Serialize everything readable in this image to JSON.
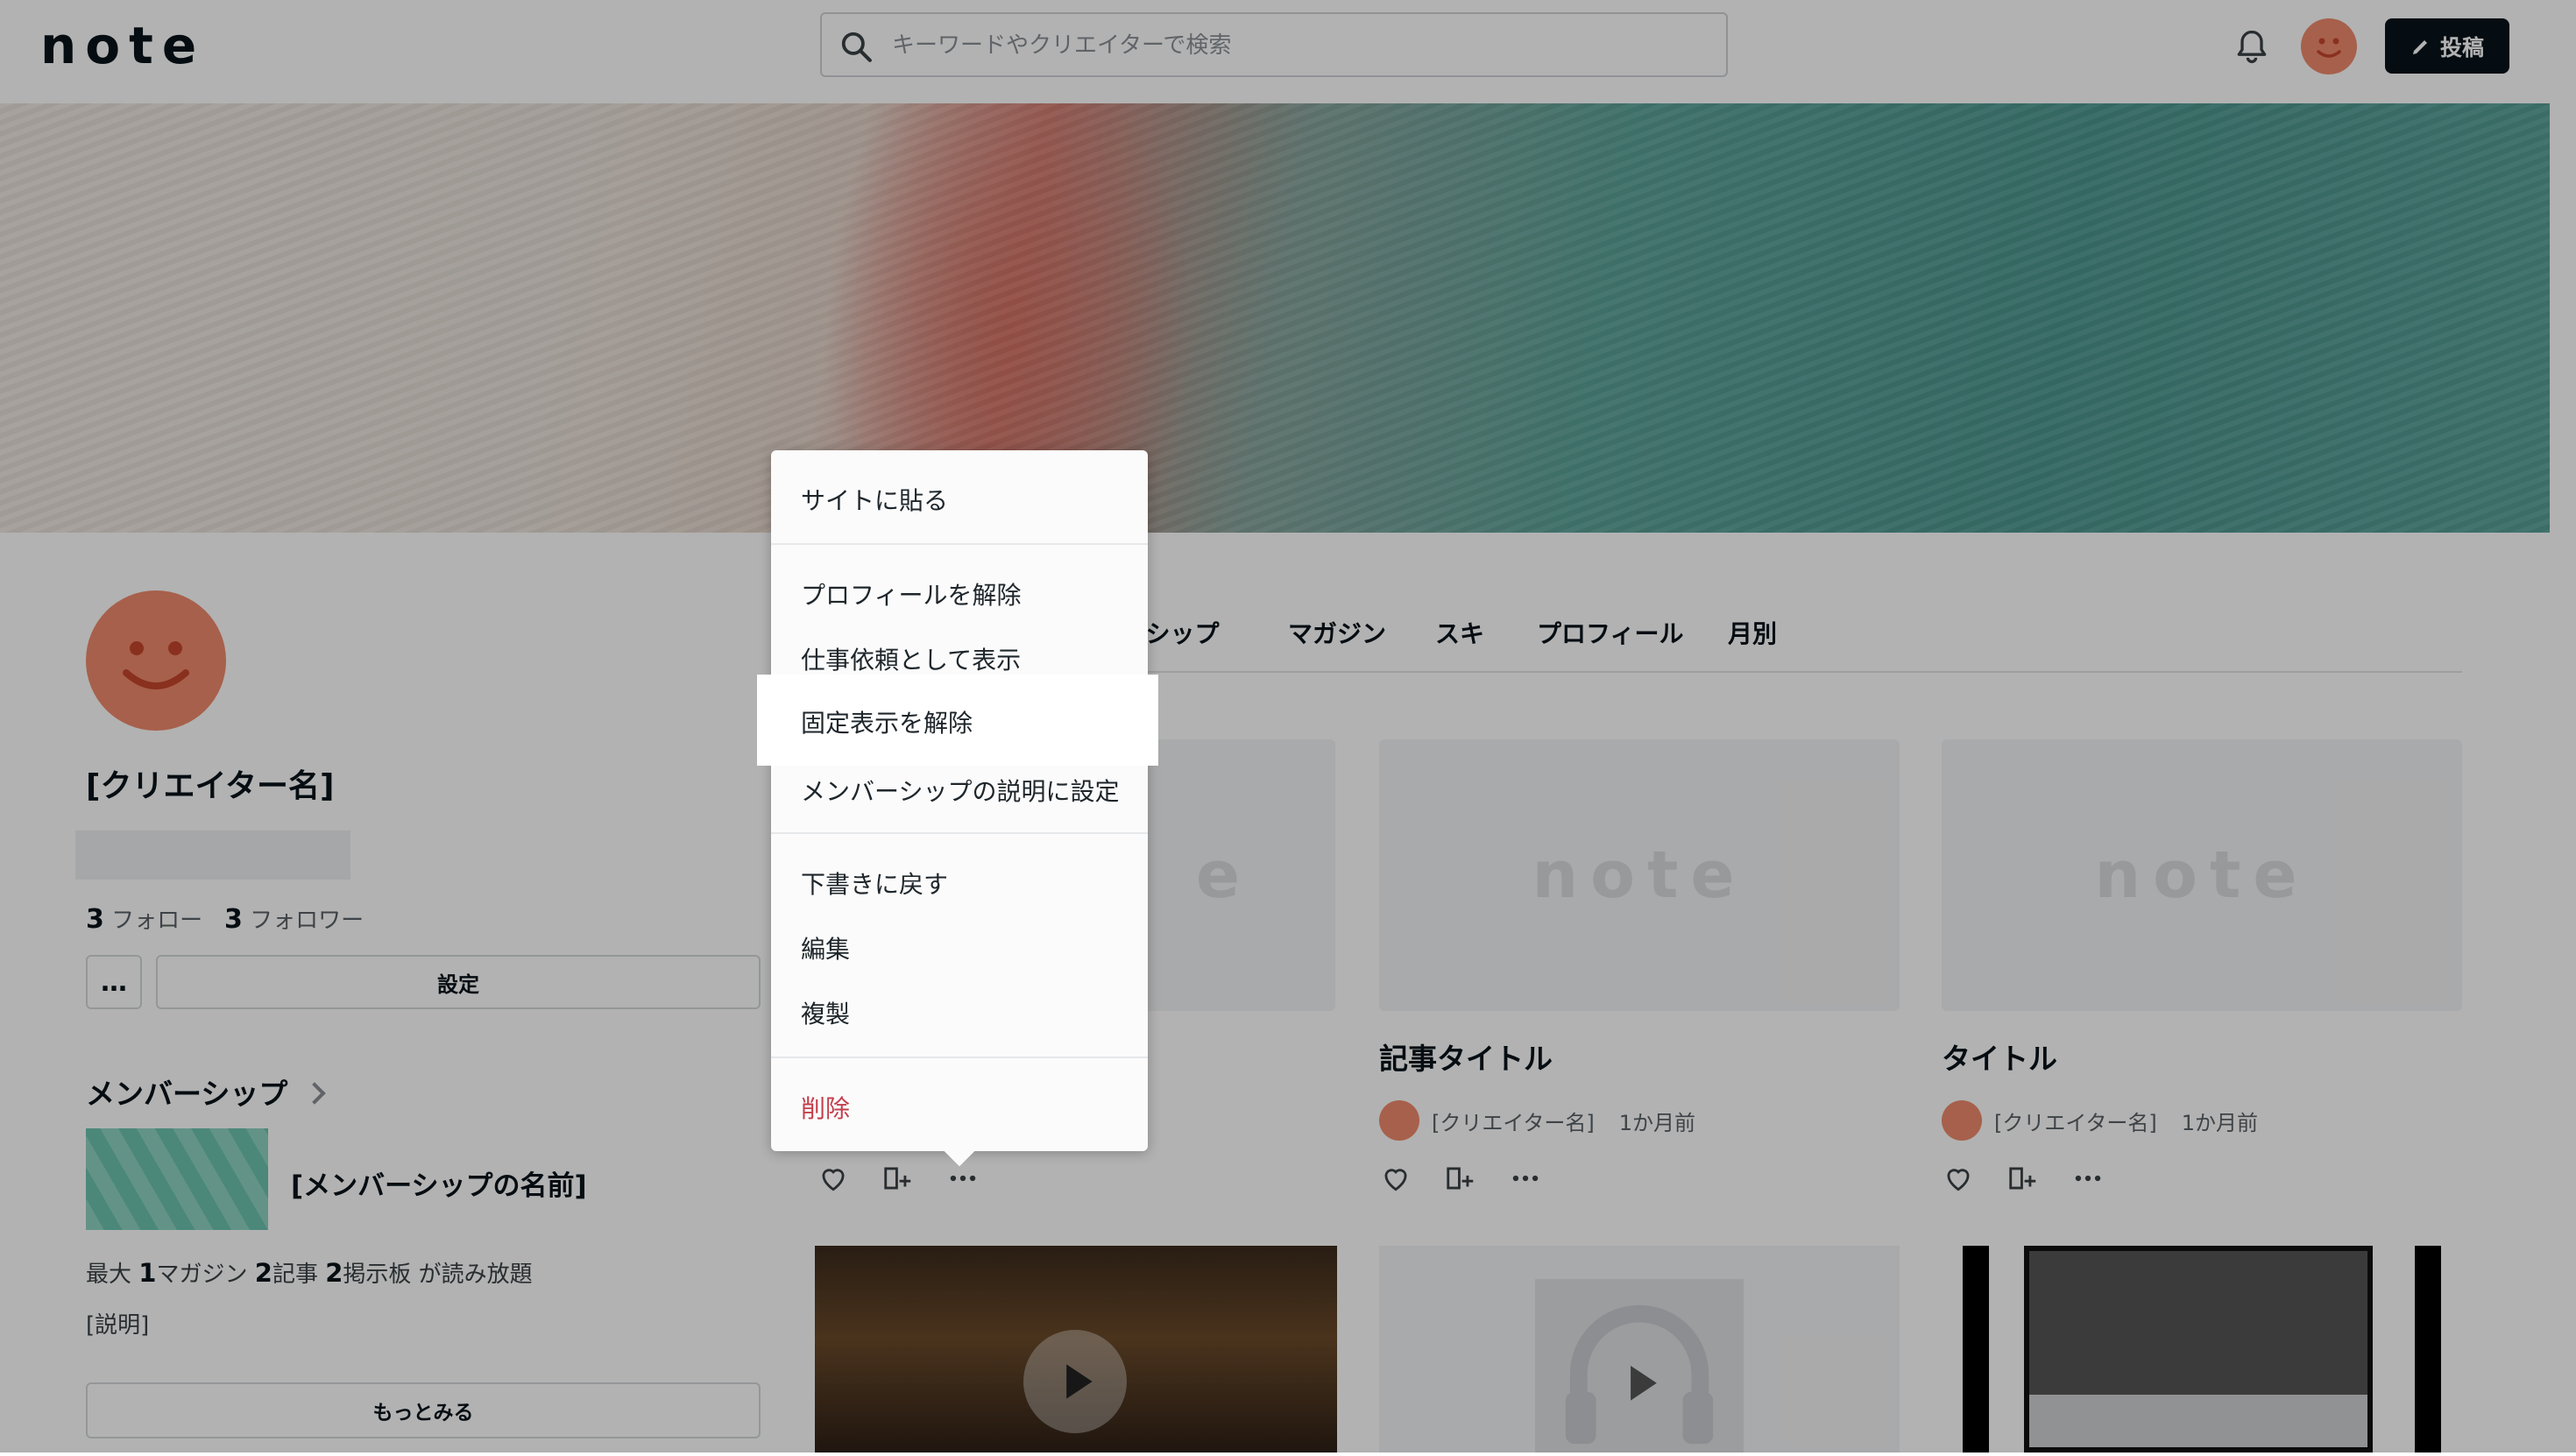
{
  "header": {
    "logo": "note",
    "search_placeholder": "キーワードやクリエイターで検索",
    "post_label": "投稿"
  },
  "profile": {
    "creator_name": "[クリエイター名]",
    "follow_count": "3",
    "follow_label": "フォロー",
    "follower_count": "3",
    "follower_label": "フォロワー",
    "more_label": "…",
    "settings_label": "設定"
  },
  "membership": {
    "heading": "メンバーシップ",
    "name": "[メンバーシップの名前]",
    "desc_prefix": "最大",
    "magazine_count": "1",
    "magazine_label": "マガジン",
    "article_count": "2",
    "article_label": "記事",
    "board_count": "2",
    "board_label": "掲示板 が読み放題",
    "description": "[説明]",
    "see_more_label": "もっとみる"
  },
  "tabs": [
    {
      "label": "ーシップ"
    },
    {
      "label": "マガジン"
    },
    {
      "label": "スキ"
    },
    {
      "label": "プロフィール"
    },
    {
      "label": "月別"
    }
  ],
  "cards": [
    {
      "thumb_logo": "e",
      "title": "",
      "creator": "",
      "ago": ""
    },
    {
      "thumb_logo": "note",
      "title": "記事タイトル",
      "creator": "[クリエイター名]",
      "ago": "1か月前"
    },
    {
      "thumb_logo": "note",
      "title": "タイトル",
      "creator": "[クリエイター名]",
      "ago": "1か月前"
    }
  ],
  "menu": {
    "items": [
      {
        "label": "サイトに貼る"
      },
      {
        "label": "プロフィールを解除"
      },
      {
        "label": "仕事依頼として表示"
      },
      {
        "label": "固定表示を解除"
      },
      {
        "label": "メンバーシップの説明に設定"
      },
      {
        "label": "下書きに戻す"
      },
      {
        "label": "編集"
      },
      {
        "label": "複製"
      },
      {
        "label": "削除"
      }
    ],
    "danger_color": "#c43d4c"
  }
}
